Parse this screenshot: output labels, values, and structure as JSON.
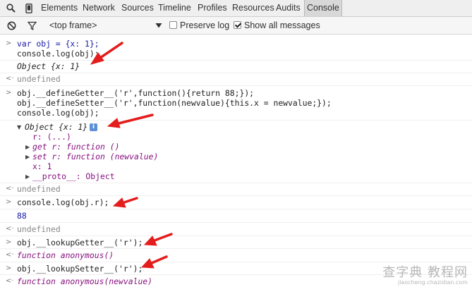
{
  "tabbar": {
    "tabs": [
      "Elements",
      "Network",
      "Sources",
      "Timeline",
      "Profiles",
      "Resources",
      "Audits",
      "Console"
    ],
    "active": "Console"
  },
  "toolbar": {
    "frame_select": "<top frame>",
    "preserve_log_label": "Preserve log",
    "preserve_log_checked": false,
    "show_all_label": "Show all messages",
    "show_all_checked": true
  },
  "console": {
    "in1": [
      "var obj = {x: 1};",
      "console.log(obj);"
    ],
    "out1": "Object {x: 1}",
    "undef1": "undefined",
    "in2": [
      "obj.__defineGetter__('r',function(){return 88;});",
      "obj.__defineSetter__('r',function(newvalue){this.x = newvalue;});",
      "console.log(obj);"
    ],
    "obj_head": "Object {x: 1}",
    "obj_r": "r: (...)",
    "obj_get": "get r: function ()",
    "obj_set": "set r: function (newvalue)",
    "obj_x": "x: 1",
    "obj_proto": "__proto__: Object",
    "undef2": "undefined",
    "in3": "console.log(obj.r);",
    "out3": "88",
    "undef3": "undefined",
    "in4": "obj.__lookupGetter__('r');",
    "out4": "function anonymous()",
    "in5": "obj.__lookupSetter__('r');",
    "out5": "function anonymous(newvalue)"
  },
  "watermark": {
    "big": "查字典 教程网",
    "small": "jiaocheng.chazidian.com"
  },
  "colors": {
    "arrow": "#e41c1c",
    "keyword": "#881280",
    "string": "#c41a16",
    "number": "#1a1aa6"
  }
}
